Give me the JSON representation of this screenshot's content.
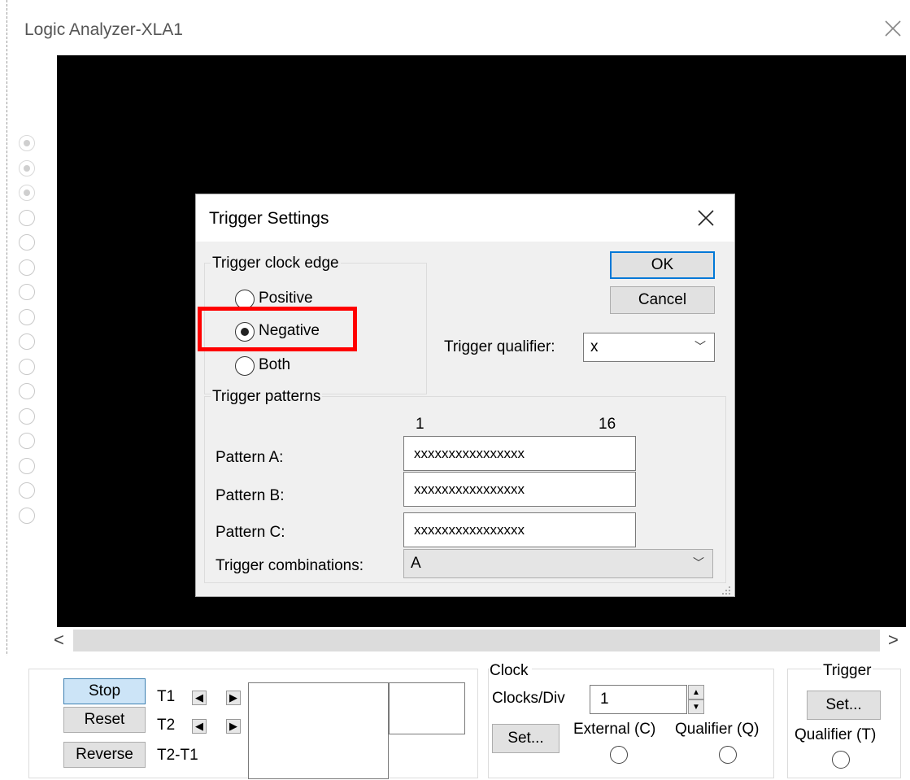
{
  "window": {
    "title": "Logic Analyzer-XLA1"
  },
  "probes": {
    "count": 16,
    "set_count": 3
  },
  "scrollbar": {
    "left_arrow": "<",
    "right_arrow": ">"
  },
  "controls": {
    "stop": "Stop",
    "reset": "Reset",
    "reverse": "Reverse",
    "t1": "T1",
    "t2": "T2",
    "t2t1": "T2-T1"
  },
  "clock": {
    "group_label": "Clock",
    "clocks_div_label": "Clocks/Div",
    "clocks_div_value": "1",
    "set_button": "Set...",
    "external_label": "External (C)",
    "qualifier_label": "Qualifier (Q)"
  },
  "trigger": {
    "group_label": "Trigger",
    "set_button": "Set...",
    "qualifier_label": "Qualifier (T)"
  },
  "dialog": {
    "title": "Trigger Settings",
    "edge_group": "Trigger clock edge",
    "edge_options": [
      "Positive",
      "Negative",
      "Both"
    ],
    "edge_selected": "Negative",
    "ok": "OK",
    "cancel": "Cancel",
    "qualifier_label": "Trigger qualifier:",
    "qualifier_value": "x",
    "patterns_group": "Trigger patterns",
    "bit_start": "1",
    "bit_end": "16",
    "pattern_a_label": "Pattern A:",
    "pattern_a_value": "xxxxxxxxxxxxxxxx",
    "pattern_b_label": "Pattern B:",
    "pattern_b_value": "xxxxxxxxxxxxxxxx",
    "pattern_c_label": "Pattern C:",
    "pattern_c_value": "xxxxxxxxxxxxxxxx",
    "combinations_label": "Trigger combinations:",
    "combinations_value": "A"
  },
  "colors": {
    "screen": "#000000",
    "highlight": "#ff0000",
    "primary_button": "#cce4f7",
    "dialog_bg": "#f0f0f0"
  }
}
